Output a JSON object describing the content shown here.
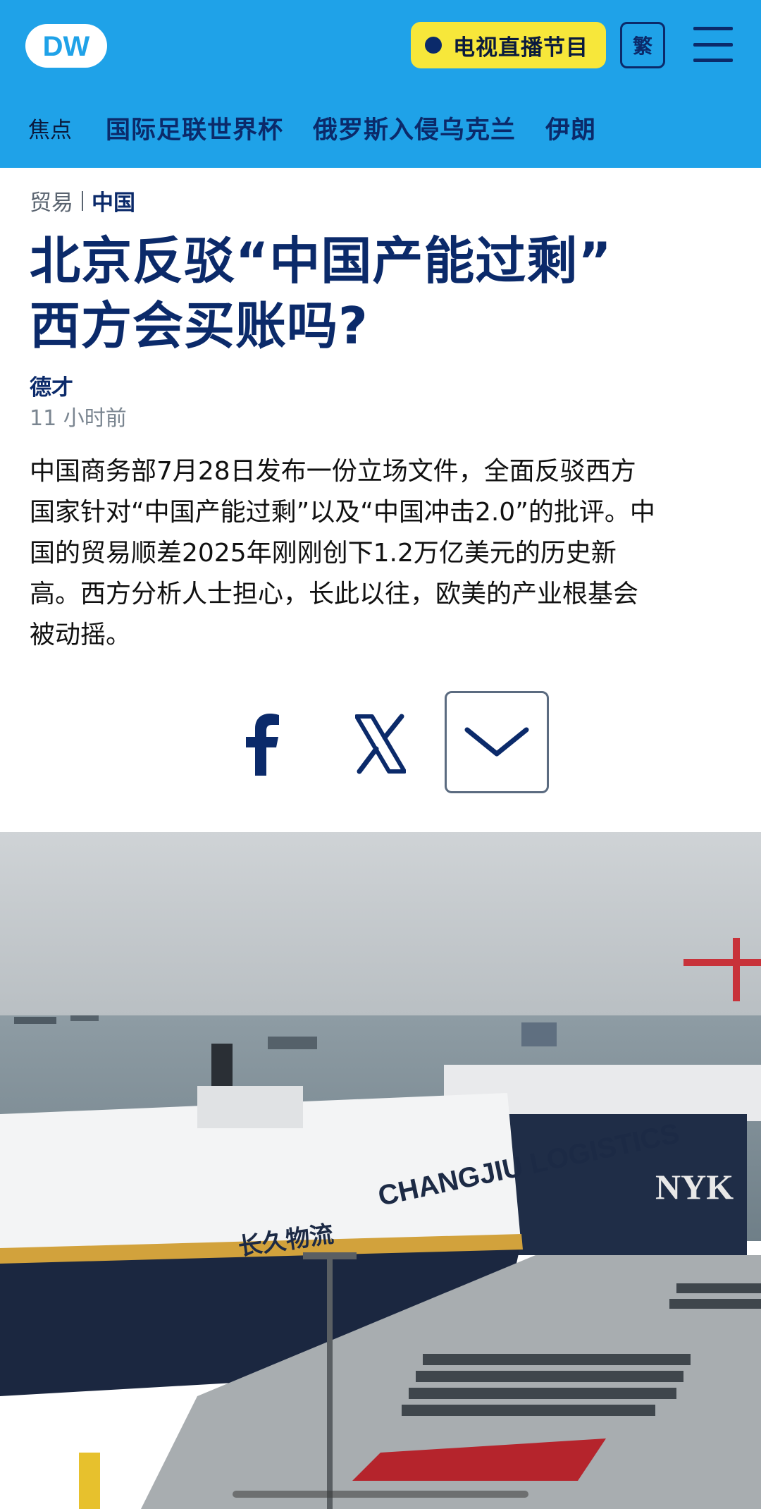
{
  "header": {
    "logo_text": "DW",
    "live_button_label": "电视直播节目",
    "language_button_label": "繁",
    "menu_icon": "hamburger-menu-icon",
    "background_color": "#1fa2e8",
    "accent_color": "#0b2a6a",
    "live_button_color": "#f7e73a"
  },
  "nav": {
    "label": "焦点",
    "links": [
      "国际足联世界杯",
      "俄罗斯入侵乌克兰",
      "伊朗"
    ]
  },
  "article": {
    "breadcrumb": [
      "贸易",
      "中国"
    ],
    "headline_lines": [
      "北京反驳“中国产能过剩”",
      "西方会买账吗?"
    ],
    "author": "德才",
    "timestamp": "11 小时前",
    "lead_lines": [
      "中国商务部7月28日发布一份立场文件，全面反驳西方",
      "国家针对“中国产能过剩”以及“中国冲击2.0”的批评。中",
      "国的贸易顺差2025年刚刚创下1.2万亿美元的历史新",
      "高。西方分析人士担心，长此以往，欧美的产业根基会",
      "被动摇。"
    ]
  },
  "share": {
    "icons": [
      "facebook-icon",
      "x-icon",
      "chevron-down-icon"
    ]
  },
  "photo": {
    "ship_lettering": "CHANGJIU LOGISTICS",
    "ship_lettering_cn": "长久物流",
    "second_ship_lettering": "NYK"
  }
}
